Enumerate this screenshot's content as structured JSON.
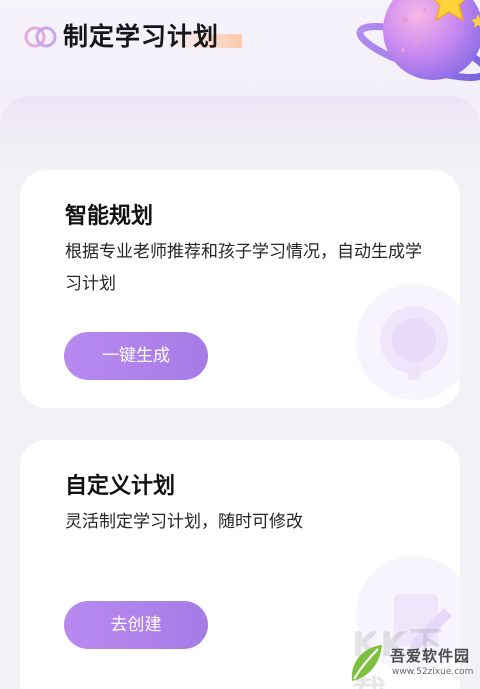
{
  "header": {
    "title": "制定学习计划",
    "logo_icon": "double-circle-icon",
    "decoration_icon": "planet-star-icon"
  },
  "cards": [
    {
      "title": "智能规划",
      "description": "根据专业老师推荐和孩子学习情况，自动生成学习计划",
      "button_label": "一键生成",
      "decoration_icon": "brain-bulb-icon"
    },
    {
      "title": "自定义计划",
      "description": "灵活制定学习计划，随时可修改",
      "button_label": "去创建",
      "decoration_icon": "pencil-icon"
    }
  ],
  "watermark": {
    "site_name": "吾爱软件园",
    "url": "www.52zixue.com",
    "overlay_text": "KK下载"
  },
  "colors": {
    "accent": "#b088ec",
    "page_bg": "#f2f1f5",
    "card_bg": "#ffffff"
  }
}
